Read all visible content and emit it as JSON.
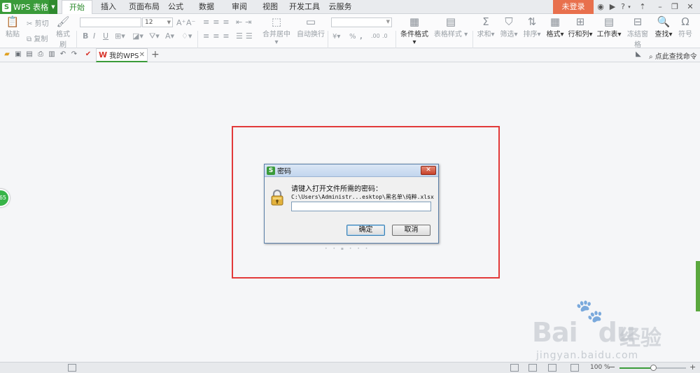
{
  "app": {
    "title": "WPS 表格",
    "logo": "S"
  },
  "tabs": [
    {
      "label": "开始",
      "active": true
    },
    {
      "label": "插入"
    },
    {
      "label": "页面布局"
    },
    {
      "label": "公式"
    },
    {
      "label": "数据"
    },
    {
      "label": "审阅"
    },
    {
      "label": "视图"
    },
    {
      "label": "开发工具"
    },
    {
      "label": "云服务"
    }
  ],
  "header": {
    "login": "未登录",
    "help": "?"
  },
  "ribbon": {
    "paste": "粘贴",
    "cut": "剪切",
    "copy": "复制",
    "format_painter": "格式刷",
    "font_size": "12",
    "bold": "B",
    "italic": "I",
    "underline": "U",
    "merge_center": "合并居中",
    "wrap_text": "自动换行",
    "conditional_format": "条件格式",
    "table_style": "表格样式",
    "sum": "求和",
    "filter": "筛选",
    "sort": "排序",
    "format": "格式",
    "row_col": "行和列",
    "worksheet": "工作表",
    "freeze": "冻结窗格",
    "find": "查找",
    "symbol": "符号",
    "currency": "¥",
    "percent": "%",
    "thousands": ",",
    "decimal_inc": ".00",
    "decimal_dec": ".0"
  },
  "quickbar": {
    "doc_tab": "我的WPS",
    "find_command": "点此查找命令"
  },
  "side_badge": "65",
  "dialog": {
    "title": "密码",
    "prompt": "请键入打开文件所需的密码：",
    "path": "C:\\Users\\Administr...esktop\\黑名单\\纯粹.xlsx",
    "password_value": "",
    "ok": "确定",
    "cancel": "取消"
  },
  "statusbar": {
    "zoom": "100 %",
    "zoom_level_percent": 50
  },
  "watermark": {
    "brand": "Bai",
    "brand2": "du",
    "cn": "经验",
    "url": "jingyan.baidu.com"
  },
  "colors": {
    "accent_green": "#3a9b3a",
    "login_orange": "#e8704d",
    "frame_red": "#e23a3a"
  }
}
